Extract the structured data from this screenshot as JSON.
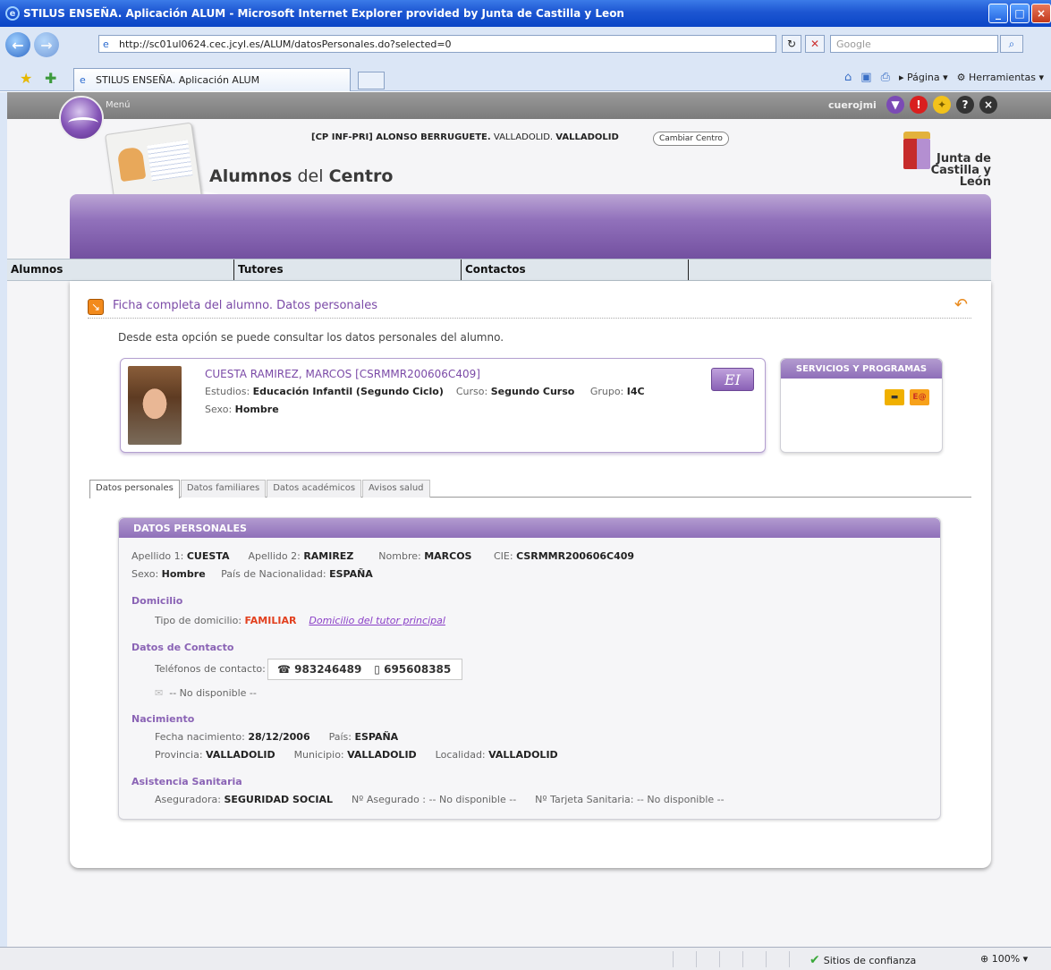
{
  "window": {
    "title": "STILUS ENSEÑA. Aplicación ALUM - Microsoft Internet Explorer provided by Junta de Castilla y Leon"
  },
  "browser": {
    "url": "http://sc01ul0624.cec.jcyl.es/ALUM/datosPersonales.do?selected=0",
    "search_placeholder": "Google",
    "tab_title": "STILUS ENSEÑA. Aplicación ALUM",
    "page_menu": "Página",
    "tools_menu": "Herramientas",
    "status_zone": "Sitios de confianza",
    "zoom": "100%"
  },
  "app": {
    "menu_label": "Menú",
    "user": "cuerojmi",
    "centre_code": "[CP INF-PRI] ALONSO BERRUGUETE.",
    "centre_city": "VALLADOLID.",
    "centre_province": "VALLADOLID",
    "change_centre": "Cambiar Centro",
    "title_part1": "Alumnos",
    "title_part2": "del",
    "title_part3": "Centro",
    "logo_line1": "Junta de",
    "logo_line2": "Castilla y León",
    "main_menu": [
      "Alumnos",
      "Tutores",
      "Contactos"
    ]
  },
  "section": {
    "title": "Ficha completa del alumno. Datos personales",
    "intro": "Desde esta opción se puede consultar los datos  personales  del alumno."
  },
  "student": {
    "name": "CUESTA RAMIREZ, MARCOS  [CSRMMR200606C409]",
    "studies_label": "Estudios:",
    "studies": "Educación Infantil (Segundo Ciclo)",
    "course_label": "Curso:",
    "course": "Segundo Curso",
    "group_label": "Grupo:",
    "group": "I4C",
    "sex_label": "Sexo:",
    "sex": "Hombre",
    "badge": "EI"
  },
  "services": {
    "title": "SERVICIOS Y PROGRAMAS"
  },
  "subtabs": [
    "Datos personales",
    "Datos familiares",
    "Datos académicos",
    "Avisos salud"
  ],
  "personal": {
    "header": "DATOS PERSONALES",
    "surname1_label": "Apellido 1:",
    "surname1": "CUESTA",
    "surname2_label": "Apellido 2:",
    "surname2": "RAMIREZ",
    "name_label": "Nombre:",
    "name": "MARCOS",
    "cie_label": "CIE:",
    "cie": "CSRMMR200606C409",
    "sex_label": "Sexo:",
    "sex": "Hombre",
    "nationality_label": "País de Nacionalidad:",
    "nationality": "ESPAÑA",
    "domicile_title": "Domicilio",
    "domicile_type_label": "Tipo de domicilio:",
    "domicile_type": "FAMILIAR",
    "domicile_link": "Domicilio del tutor principal",
    "contact_title": "Datos de Contacto",
    "phones_label": "Teléfonos de contacto:",
    "phone1": "983246489",
    "phone2": "695608385",
    "email": "-- No disponible --",
    "birth_title": "Nacimiento",
    "birth_date_label": "Fecha nacimiento:",
    "birth_date": "28/12/2006",
    "birth_country_label": "País:",
    "birth_country": "ESPAÑA",
    "province_label": "Provincia:",
    "province": "VALLADOLID",
    "municipality_label": "Municipio:",
    "municipality": "VALLADOLID",
    "locality_label": "Localidad:",
    "locality": "VALLADOLID",
    "health_title": "Asistencia Sanitaria",
    "insurer_label": "Aseguradora:",
    "insurer": "SEGURIDAD SOCIAL",
    "insured_no_label": "Nº Asegurado :",
    "insured_no": "-- No disponible --",
    "health_card_label": "Nº Tarjeta Sanitaria:",
    "health_card": "-- No disponible --"
  }
}
